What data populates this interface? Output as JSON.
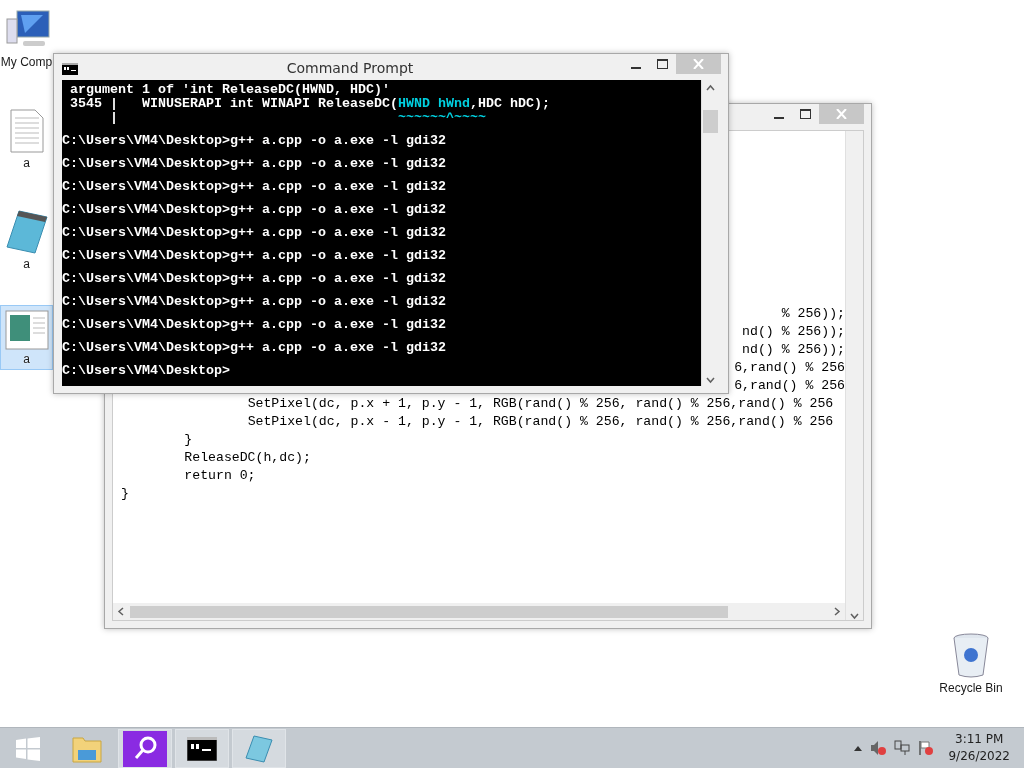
{
  "desktop_icons": [
    {
      "label": "My Comp",
      "kind": "computer",
      "selected": false
    },
    {
      "label": "a",
      "kind": "document",
      "selected": false
    },
    {
      "label": "a",
      "kind": "notepad",
      "selected": false
    },
    {
      "label": "a",
      "kind": "image",
      "selected": true
    },
    {
      "label": "Recycle Bin",
      "kind": "recycle",
      "selected": false
    }
  ],
  "editor_window": {
    "lines": [
      {
        "kind": "partial",
        "text": "% 256));"
      },
      {
        "kind": "partial",
        "text": "nd() % 256));"
      },
      {
        "kind": "partial",
        "text": "nd() % 256));"
      },
      {
        "kind": "partial",
        "text": "6,rand() % 256"
      },
      {
        "kind": "partial",
        "text": "6,rand() % 256"
      },
      {
        "kind": "code",
        "text": "\t\tSetPixel(dc, p.x + 1, p.y - 1, RGB(rand() % 256, rand() % 256,rand() % 256"
      },
      {
        "kind": "code",
        "text": "\t\tSetPixel(dc, p.x - 1, p.y - 1, RGB(rand() % 256, rand() % 256,rand() % 256"
      },
      {
        "kind": "code",
        "text": "\t}"
      },
      {
        "kind": "code",
        "text": "\tReleaseDC(h,dc);"
      },
      {
        "kind": "code",
        "text": "\treturn 0;"
      },
      {
        "kind": "code",
        "text": "}"
      }
    ]
  },
  "console_window": {
    "title": "Command Prompt",
    "lines": [
      {
        "kind": "output",
        "segments": [
          {
            "text": " argument 1 of 'int ReleaseDC(HWND, HDC)'"
          }
        ]
      },
      {
        "kind": "output",
        "segments": [
          {
            "text": " 3545 |   WINUSERAPI int WINAPI ReleaseDC("
          },
          {
            "text": "HWND hWnd",
            "color": "#00d0e0"
          },
          {
            "text": ",HDC hDC);"
          }
        ]
      },
      {
        "kind": "output",
        "segments": [
          {
            "text": "      |"
          },
          {
            "text": "                                   ~~~~~~^~~~~",
            "color": "#00d0e0"
          }
        ]
      },
      {
        "kind": "command",
        "segments": [
          {
            "text": "C:\\Users\\VM4\\Desktop>g++ a.cpp -o a.exe -l gdi32"
          }
        ]
      },
      {
        "kind": "command",
        "segments": [
          {
            "text": "C:\\Users\\VM4\\Desktop>g++ a.cpp -o a.exe -l gdi32"
          }
        ]
      },
      {
        "kind": "command",
        "segments": [
          {
            "text": "C:\\Users\\VM4\\Desktop>g++ a.cpp -o a.exe -l gdi32"
          }
        ]
      },
      {
        "kind": "command",
        "segments": [
          {
            "text": "C:\\Users\\VM4\\Desktop>g++ a.cpp -o a.exe -l gdi32"
          }
        ]
      },
      {
        "kind": "command",
        "segments": [
          {
            "text": "C:\\Users\\VM4\\Desktop>g++ a.cpp -o a.exe -l gdi32"
          }
        ]
      },
      {
        "kind": "command",
        "segments": [
          {
            "text": "C:\\Users\\VM4\\Desktop>g++ a.cpp -o a.exe -l gdi32"
          }
        ]
      },
      {
        "kind": "command",
        "segments": [
          {
            "text": "C:\\Users\\VM4\\Desktop>g++ a.cpp -o a.exe -l gdi32"
          }
        ]
      },
      {
        "kind": "command",
        "segments": [
          {
            "text": "C:\\Users\\VM4\\Desktop>g++ a.cpp -o a.exe -l gdi32"
          }
        ]
      },
      {
        "kind": "command",
        "segments": [
          {
            "text": "C:\\Users\\VM4\\Desktop>g++ a.cpp -o a.exe -l gdi32"
          }
        ]
      },
      {
        "kind": "command",
        "segments": [
          {
            "text": "C:\\Users\\VM4\\Desktop>g++ a.cpp -o a.exe -l gdi32"
          }
        ]
      },
      {
        "kind": "command",
        "segments": [
          {
            "text": "C:\\Users\\VM4\\Desktop>"
          }
        ]
      }
    ]
  },
  "taskbar": {
    "apps": [
      {
        "kind": "start"
      },
      {
        "kind": "explorer"
      },
      {
        "kind": "search"
      },
      {
        "kind": "console"
      },
      {
        "kind": "notepad"
      }
    ],
    "tray": {
      "time": "3:11 PM",
      "date": "9/26/2022"
    }
  }
}
